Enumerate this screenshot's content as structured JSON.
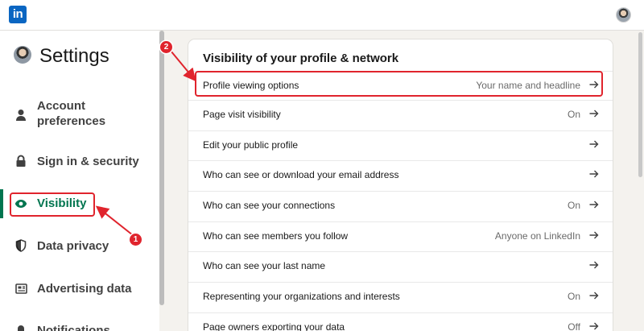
{
  "brand": {
    "logo_text": "in",
    "accent": "#0a66c2",
    "active_color": "#01754f",
    "annotation_color": "#e0242d"
  },
  "sidebar": {
    "title": "Settings",
    "items": [
      {
        "label": "Account preferences",
        "icon": "person-icon",
        "active": false
      },
      {
        "label": "Sign in & security",
        "icon": "lock-icon",
        "active": false
      },
      {
        "label": "Visibility",
        "icon": "eye-icon",
        "active": true
      },
      {
        "label": "Data privacy",
        "icon": "shield-icon",
        "active": false
      },
      {
        "label": "Advertising data",
        "icon": "newspaper-icon",
        "active": false
      },
      {
        "label": "Notifications",
        "icon": "bell-icon",
        "active": false
      }
    ]
  },
  "annotations": {
    "step1": "1",
    "step2": "2"
  },
  "main": {
    "section_title": "Visibility of your profile & network",
    "rows": [
      {
        "label": "Profile viewing options",
        "value": "Your name and headline"
      },
      {
        "label": "Page visit visibility",
        "value": "On"
      },
      {
        "label": "Edit your public profile",
        "value": ""
      },
      {
        "label": "Who can see or download your email address",
        "value": ""
      },
      {
        "label": "Who can see your connections",
        "value": "On"
      },
      {
        "label": "Who can see members you follow",
        "value": "Anyone on LinkedIn"
      },
      {
        "label": "Who can see your last name",
        "value": ""
      },
      {
        "label": "Representing your organizations and interests",
        "value": "On"
      },
      {
        "label": "Page owners exporting your data",
        "value": "Off"
      }
    ]
  }
}
